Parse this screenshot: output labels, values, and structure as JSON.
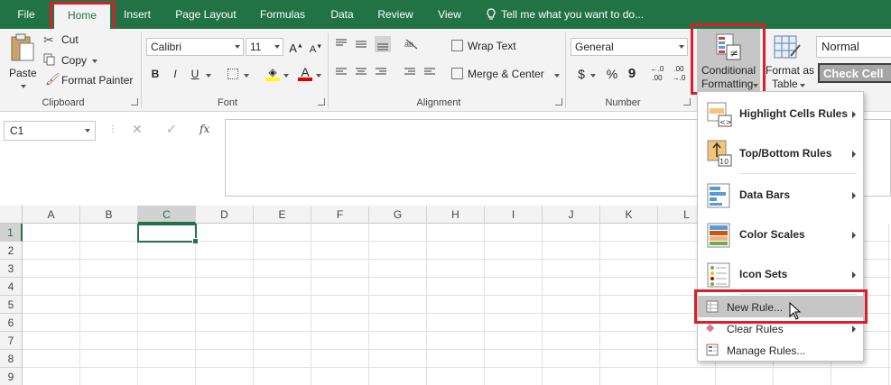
{
  "tabs": [
    "File",
    "Home",
    "Insert",
    "Page Layout",
    "Formulas",
    "Data",
    "Review",
    "View"
  ],
  "tell_me": "Tell me what you want to do...",
  "clipboard": {
    "paste": "Paste",
    "cut": "Cut",
    "copy": "Copy",
    "format_painter": "Format Painter",
    "label": "Clipboard"
  },
  "font": {
    "name": "Calibri",
    "size": "11",
    "bold": "B",
    "italic": "I",
    "underline": "U",
    "label": "Font"
  },
  "alignment": {
    "wrap_text": "Wrap Text",
    "merge_center": "Merge & Center",
    "label": "Alignment"
  },
  "number": {
    "format": "General",
    "currency": "$",
    "percent": "%",
    "comma": "9",
    "label": "Number"
  },
  "styles": {
    "conditional_formatting_line1": "Conditional",
    "conditional_formatting_line2": "Formatting",
    "format_as_table_line1": "Format as",
    "format_as_table_line2": "Table",
    "normal": "Normal",
    "check_cell": "Check Cell"
  },
  "formula_bar": {
    "name_box": "C1",
    "cancel": "✕",
    "enter": "✓",
    "fx": "fx",
    "value": ""
  },
  "columns": [
    "A",
    "B",
    "C",
    "D",
    "E",
    "F",
    "G",
    "H",
    "I",
    "J",
    "K",
    "L"
  ],
  "rows": [
    "1",
    "2",
    "3",
    "4",
    "5",
    "6",
    "7",
    "8",
    "9"
  ],
  "selected_cell": "C1",
  "menu": {
    "highlight_cells_rules": "Highlight Cells Rules",
    "top_bottom_rules": "Top/Bottom Rules",
    "data_bars": "Data Bars",
    "color_scales": "Color Scales",
    "icon_sets": "Icon Sets",
    "new_rule": "New Rule...",
    "clear_rules": "Clear Rules",
    "manage_rules": "Manage Rules...",
    "top_bottom_icon_text": "10",
    "highlight_icon_text": "<>"
  },
  "colors": {
    "accent": "#217346",
    "highlight_red": "#d9202a",
    "font_color": "#e00000",
    "highlight_yellow": "#ffff00"
  }
}
